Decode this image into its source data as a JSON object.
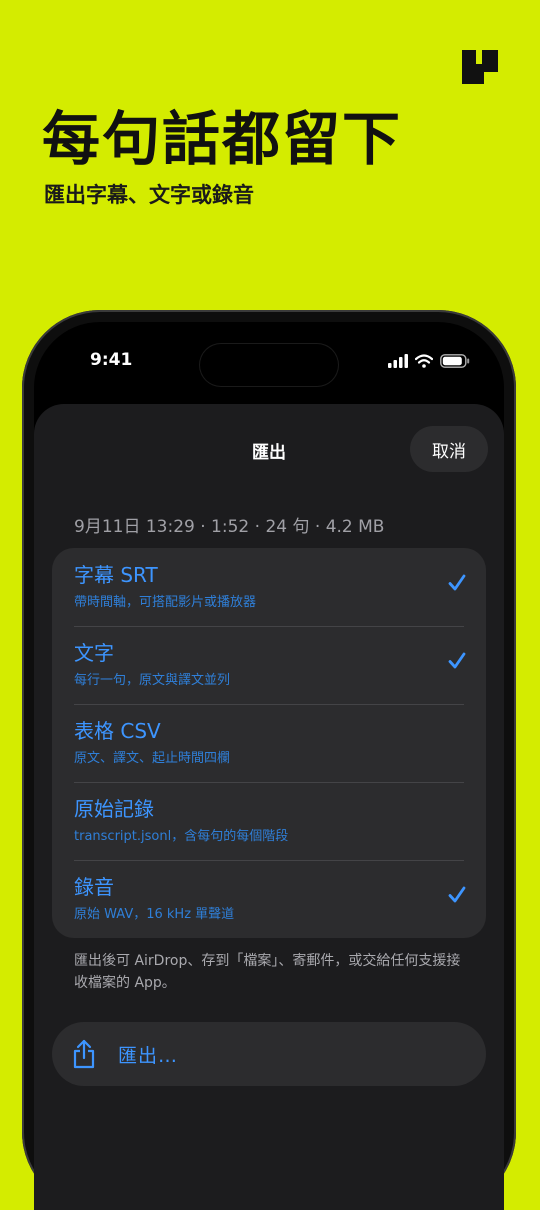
{
  "headline": "每句話都留下",
  "subheadline": "匯出字幕、文字或錄音",
  "status_bar": {
    "time": "9:41"
  },
  "sheet": {
    "title": "匯出",
    "cancel_label": "取消",
    "meta": "9月11日 13:29 · 1:52 · 24 句 · 4.2 MB",
    "options": [
      {
        "title": "字幕 SRT",
        "desc": "帶時間軸，可搭配影片或播放器",
        "checked": true
      },
      {
        "title": "文字",
        "desc": "每行一句，原文與譯文並列",
        "checked": true
      },
      {
        "title": "表格 CSV",
        "desc": "原文、譯文、起止時間四欄",
        "checked": false
      },
      {
        "title": "原始記錄",
        "desc": "transcript.jsonl，含每句的每個階段",
        "checked": false
      },
      {
        "title": "錄音",
        "desc": "原始 WAV，16 kHz 單聲道",
        "checked": true
      }
    ],
    "note": "匯出後可 AirDrop、存到「檔案」、寄郵件，或交給任何支援接收檔案的 App。",
    "export_label": "匯出…"
  },
  "colors": {
    "background": "#d4ec00",
    "accent": "#3d95ff",
    "sheet": "#1c1c1e",
    "card": "#2c2c2e"
  }
}
